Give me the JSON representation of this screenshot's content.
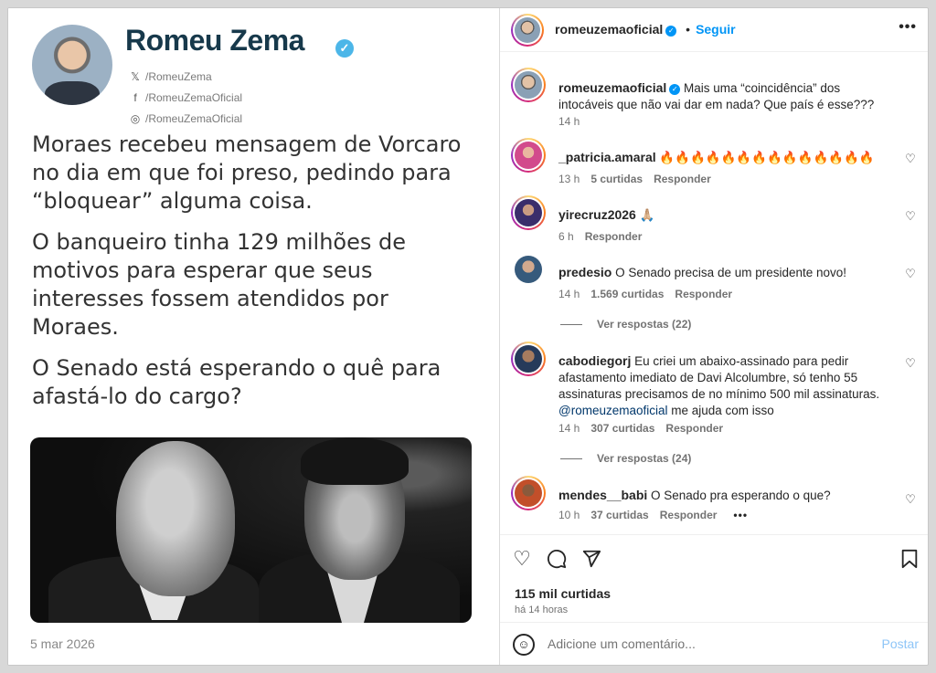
{
  "post_image": {
    "author_name": "Romeu Zema",
    "socials": [
      {
        "icon": "x-icon",
        "glyph": "𝕏",
        "handle": "/RomeuZema"
      },
      {
        "icon": "facebook-icon",
        "glyph": "f",
        "handle": "/RomeuZemaOficial"
      },
      {
        "icon": "instagram-icon",
        "glyph": "◎",
        "handle": "/RomeuZemaOficial"
      }
    ],
    "paragraphs": [
      "Moraes recebeu mensagem de Vorcaro no dia em que foi preso, pedindo para “bloquear” alguma coisa.",
      "O banqueiro tinha 129 milhões de motivos para esperar que seus interesses fossem atendidos por Moraes.",
      "O Senado está esperando o quê para afastá-lo do cargo?"
    ],
    "date": "5 mar 2026"
  },
  "header": {
    "username": "romeuzemaoficial",
    "separator": "•",
    "follow": "Seguir",
    "more": "•••"
  },
  "caption": {
    "username": "romeuzemaoficial",
    "text": "Mais uma “coincidência” dos intocáveis que não vai dar em nada? Que país é esse???",
    "time": "14 h"
  },
  "comments": [
    {
      "username": "_patricia.amaral",
      "text": "🔥🔥🔥🔥🔥🔥🔥🔥🔥🔥🔥🔥🔥🔥",
      "time": "13 h",
      "likes": "5 curtidas",
      "reply": "Responder"
    },
    {
      "username": "yirecruz2026",
      "text": "🙏🏼",
      "time": "6 h",
      "likes": "",
      "reply": "Responder"
    },
    {
      "username": "predesio",
      "text": "O Senado precisa de um presidente novo!",
      "time": "14 h",
      "likes": "1.569 curtidas",
      "reply": "Responder",
      "view_replies": "Ver respostas (22)"
    },
    {
      "username": "cabodiegorj",
      "text": "Eu criei um abaixo-assinado para pedir afastamento imediato de Davi Alcolumbre, só tenho 55 assinaturas precisamos de no mínimo 500 mil assinaturas.",
      "mention": "@romeuzemaoficial",
      "text_after": " me ajuda com isso",
      "time": "14 h",
      "likes": "307 curtidas",
      "reply": "Responder",
      "view_replies": "Ver respostas (24)"
    },
    {
      "username": "mendes__babi",
      "text": "O Senado pra esperando o que?",
      "time": "10 h",
      "likes": "37 curtidas",
      "reply": "Responder",
      "more": "•••"
    }
  ],
  "actions": {
    "likes": "115 mil curtidas",
    "when": "há 14 horas"
  },
  "add_comment": {
    "placeholder": "Adicione um comentário...",
    "post": "Postar"
  }
}
